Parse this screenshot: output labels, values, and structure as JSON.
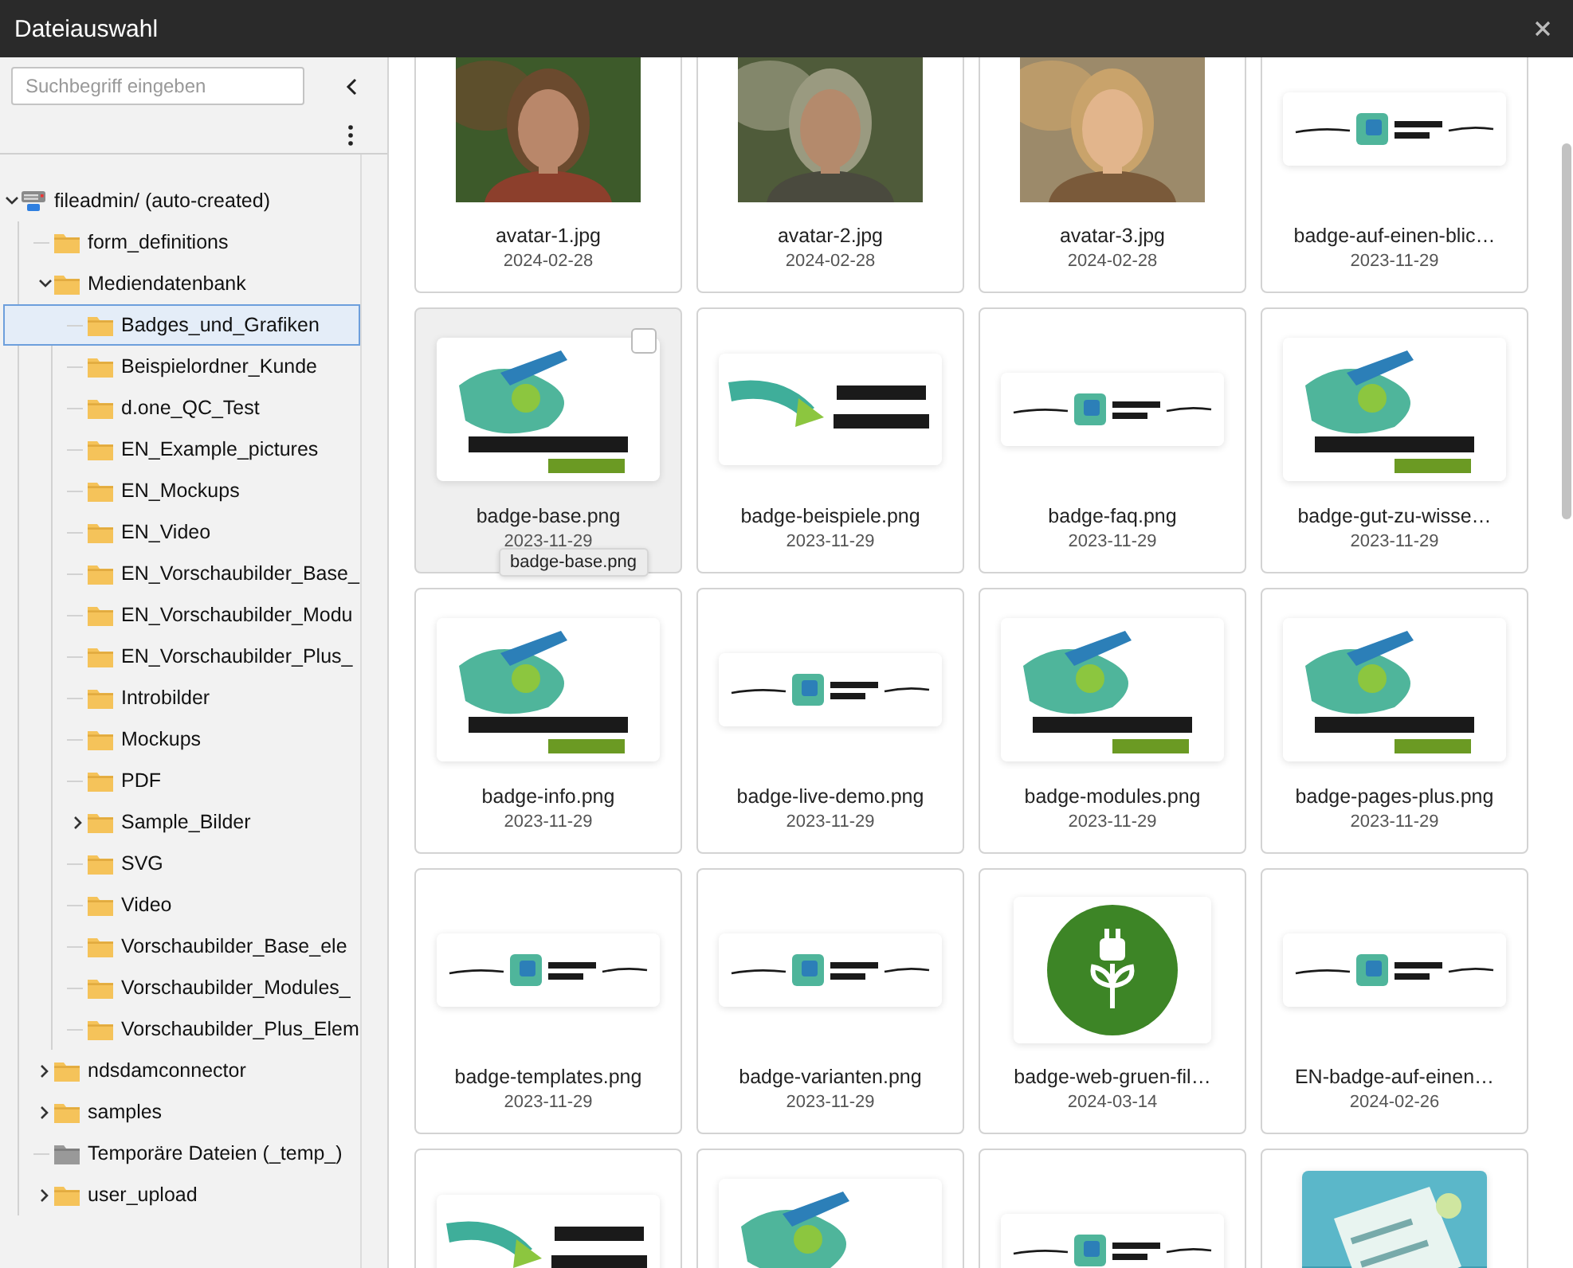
{
  "window": {
    "title": "Dateiauswahl"
  },
  "sidebar": {
    "search": {
      "placeholder": "Suchbegriff eingeben"
    },
    "tree": [
      {
        "label": "fileadmin/ (auto-created)",
        "kind": "storage",
        "expandable": true,
        "expanded": true,
        "selected": false,
        "children": [
          {
            "label": "form_definitions",
            "kind": "folder",
            "expandable": false,
            "selected": false
          },
          {
            "label": "Mediendatenbank",
            "kind": "folder",
            "expandable": true,
            "expanded": true,
            "selected": false,
            "children": [
              {
                "label": "Badges_und_Grafiken",
                "kind": "folder",
                "expandable": false,
                "selected": true
              },
              {
                "label": "Beispielordner_Kunde",
                "kind": "folder",
                "expandable": false,
                "selected": false
              },
              {
                "label": "d.one_QC_Test",
                "kind": "folder",
                "expandable": false,
                "selected": false
              },
              {
                "label": "EN_Example_pictures",
                "kind": "folder",
                "expandable": false,
                "selected": false
              },
              {
                "label": "EN_Mockups",
                "kind": "folder",
                "expandable": false,
                "selected": false
              },
              {
                "label": "EN_Video",
                "kind": "folder",
                "expandable": false,
                "selected": false
              },
              {
                "label": "EN_Vorschaubilder_Base_",
                "kind": "folder",
                "expandable": false,
                "selected": false
              },
              {
                "label": "EN_Vorschaubilder_Modu",
                "kind": "folder",
                "expandable": false,
                "selected": false
              },
              {
                "label": "EN_Vorschaubilder_Plus_",
                "kind": "folder",
                "expandable": false,
                "selected": false
              },
              {
                "label": "Introbilder",
                "kind": "folder",
                "expandable": false,
                "selected": false
              },
              {
                "label": "Mockups",
                "kind": "folder",
                "expandable": false,
                "selected": false
              },
              {
                "label": "PDF",
                "kind": "folder",
                "expandable": false,
                "selected": false
              },
              {
                "label": "Sample_Bilder",
                "kind": "folder",
                "expandable": true,
                "expanded": false,
                "selected": false
              },
              {
                "label": "SVG",
                "kind": "folder",
                "expandable": false,
                "selected": false
              },
              {
                "label": "Video",
                "kind": "folder",
                "expandable": false,
                "selected": false
              },
              {
                "label": "Vorschaubilder_Base_ele",
                "kind": "folder",
                "expandable": false,
                "selected": false
              },
              {
                "label": "Vorschaubilder_Modules_",
                "kind": "folder",
                "expandable": false,
                "selected": false
              },
              {
                "label": "Vorschaubilder_Plus_Elem",
                "kind": "folder",
                "expandable": false,
                "selected": false
              }
            ]
          },
          {
            "label": "ndsdamconnector",
            "kind": "folder",
            "expandable": true,
            "expanded": false,
            "selected": false
          },
          {
            "label": "samples",
            "kind": "folder",
            "expandable": true,
            "expanded": false,
            "selected": false
          },
          {
            "label": "Temporäre Dateien (_temp_)",
            "kind": "temp-folder",
            "expandable": false,
            "selected": false
          },
          {
            "label": "user_upload",
            "kind": "folder",
            "expandable": true,
            "expanded": false,
            "selected": false
          }
        ]
      }
    ]
  },
  "files": [
    {
      "kind": "picture",
      "name": "avatar-1.jpg",
      "date": "2024-02-28",
      "hovered": false,
      "checked": false
    },
    {
      "kind": "picture",
      "name": "avatar-2.jpg",
      "date": "2024-02-28",
      "hovered": false,
      "checked": false
    },
    {
      "kind": "picture",
      "name": "avatar-3.jpg",
      "date": "2024-02-28",
      "hovered": false,
      "checked": false
    },
    {
      "kind": "picture",
      "name": "badge-auf-einen-blic…",
      "date": "2023-11-29",
      "hovered": false,
      "checked": false
    },
    {
      "kind": "picture",
      "name": "badge-base.png",
      "date": "2023-11-29",
      "hovered": true,
      "checked": false,
      "tooltip": "badge-base.png"
    },
    {
      "kind": "picture",
      "name": "badge-beispiele.png",
      "date": "2023-11-29",
      "hovered": false,
      "checked": false
    },
    {
      "kind": "picture",
      "name": "badge-faq.png",
      "date": "2023-11-29",
      "hovered": false,
      "checked": false
    },
    {
      "kind": "picture",
      "name": "badge-gut-zu-wisse…",
      "date": "2023-11-29",
      "hovered": false,
      "checked": false
    },
    {
      "kind": "picture",
      "name": "badge-info.png",
      "date": "2023-11-29",
      "hovered": false,
      "checked": false
    },
    {
      "kind": "picture",
      "name": "badge-live-demo.png",
      "date": "2023-11-29",
      "hovered": false,
      "checked": false
    },
    {
      "kind": "picture",
      "name": "badge-modules.png",
      "date": "2023-11-29",
      "hovered": false,
      "checked": false
    },
    {
      "kind": "picture",
      "name": "badge-pages-plus.png",
      "date": "2023-11-29",
      "hovered": false,
      "checked": false
    },
    {
      "kind": "picture",
      "name": "badge-templates.png",
      "date": "2023-11-29",
      "hovered": false,
      "checked": false
    },
    {
      "kind": "picture",
      "name": "badge-varianten.png",
      "date": "2023-11-29",
      "hovered": false,
      "checked": false
    },
    {
      "kind": "picture",
      "name": "badge-web-gruen-fil…",
      "date": "2024-03-14",
      "hovered": false,
      "checked": false
    },
    {
      "kind": "picture",
      "name": "EN-badge-auf-einen…",
      "date": "2024-02-26",
      "hovered": false,
      "checked": false
    },
    {
      "kind": "picture"
    },
    {
      "kind": "picture"
    },
    {
      "kind": "picture"
    },
    {
      "kind": "picture"
    }
  ]
}
